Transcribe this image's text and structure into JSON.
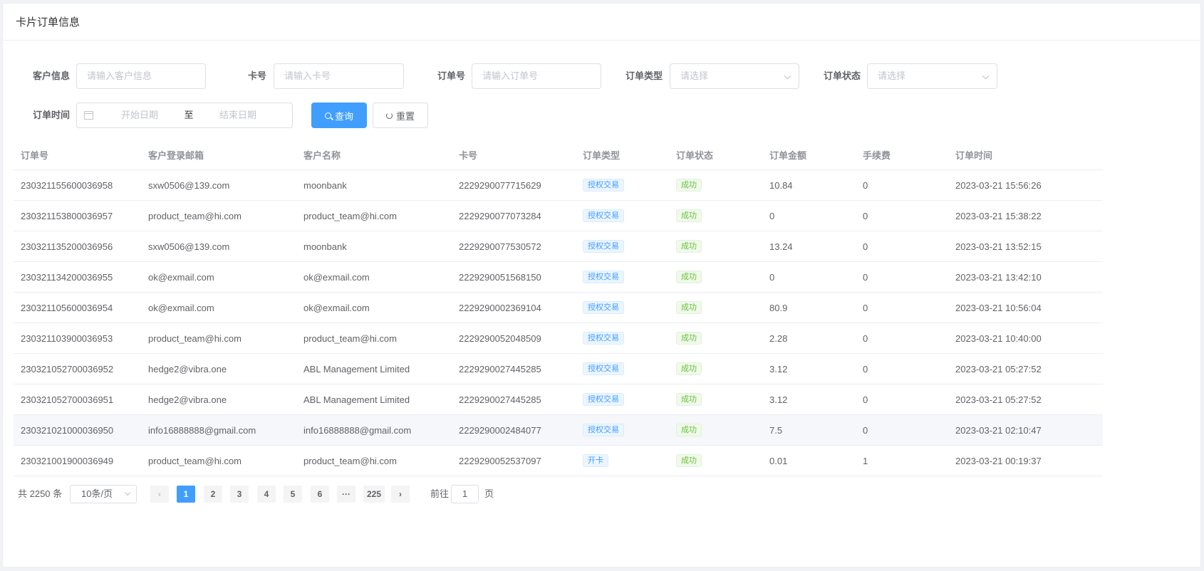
{
  "header": {
    "title": "卡片订单信息"
  },
  "filters": {
    "customer_label": "客户信息",
    "customer_placeholder": "请输入客户信息",
    "card_label": "卡号",
    "card_placeholder": "请输入卡号",
    "order_label": "订单号",
    "order_placeholder": "请输入订单号",
    "type_label": "订单类型",
    "type_placeholder": "请选择",
    "status_label": "订单状态",
    "status_placeholder": "请选择",
    "time_label": "订单时间",
    "start_placeholder": "开始日期",
    "range_separator": "至",
    "end_placeholder": "结束日期",
    "search_label": "查询",
    "reset_label": "重置"
  },
  "table": {
    "columns": [
      "订单号",
      "客户登录邮箱",
      "客户名称",
      "卡号",
      "订单类型",
      "订单状态",
      "订单金额",
      "手续费",
      "订单时间"
    ],
    "rows": [
      {
        "order_no": "230321155600036958",
        "email": "sxw0506@139.com",
        "name": "moonbank",
        "card": "2229290077715629",
        "type": "授权交易",
        "status": "成功",
        "amount": "10.84",
        "fee": "0",
        "time": "2023-03-21 15:56:26"
      },
      {
        "order_no": "230321153800036957",
        "email": "product_team@hi.com",
        "name": "product_team@hi.com",
        "card": "2229290077073284",
        "type": "授权交易",
        "status": "成功",
        "amount": "0",
        "fee": "0",
        "time": "2023-03-21 15:38:22"
      },
      {
        "order_no": "230321135200036956",
        "email": "sxw0506@139.com",
        "name": "moonbank",
        "card": "2229290077530572",
        "type": "授权交易",
        "status": "成功",
        "amount": "13.24",
        "fee": "0",
        "time": "2023-03-21 13:52:15"
      },
      {
        "order_no": "230321134200036955",
        "email": "ok@exmail.com",
        "name": "ok@exmail.com",
        "card": "2229290051568150",
        "type": "授权交易",
        "status": "成功",
        "amount": "0",
        "fee": "0",
        "time": "2023-03-21 13:42:10"
      },
      {
        "order_no": "230321105600036954",
        "email": "ok@exmail.com",
        "name": "ok@exmail.com",
        "card": "2229290002369104",
        "type": "授权交易",
        "status": "成功",
        "amount": "80.9",
        "fee": "0",
        "time": "2023-03-21 10:56:04"
      },
      {
        "order_no": "230321103900036953",
        "email": "product_team@hi.com",
        "name": "product_team@hi.com",
        "card": "2229290052048509",
        "type": "授权交易",
        "status": "成功",
        "amount": "2.28",
        "fee": "0",
        "time": "2023-03-21 10:40:00"
      },
      {
        "order_no": "230321052700036952",
        "email": "hedge2@vibra.one",
        "name": "ABL Management Limited",
        "card": "2229290027445285",
        "type": "授权交易",
        "status": "成功",
        "amount": "3.12",
        "fee": "0",
        "time": "2023-03-21 05:27:52"
      },
      {
        "order_no": "230321052700036951",
        "email": "hedge2@vibra.one",
        "name": "ABL Management Limited",
        "card": "2229290027445285",
        "type": "授权交易",
        "status": "成功",
        "amount": "3.12",
        "fee": "0",
        "time": "2023-03-21 05:27:52"
      },
      {
        "order_no": "230321021000036950",
        "email": "info16888888@gmail.com",
        "name": "info16888888@gmail.com",
        "card": "2229290002484077",
        "type": "授权交易",
        "status": "成功",
        "amount": "7.5",
        "fee": "0",
        "time": "2023-03-21 02:10:47"
      },
      {
        "order_no": "230321001900036949",
        "email": "product_team@hi.com",
        "name": "product_team@hi.com",
        "card": "2229290052537097",
        "type": "开卡",
        "status": "成功",
        "amount": "0.01",
        "fee": "1",
        "time": "2023-03-21 00:19:37"
      }
    ]
  },
  "pagination": {
    "total_text": "共 2250 条",
    "page_size": "10条/页",
    "pages": [
      "1",
      "2",
      "3",
      "4",
      "5",
      "6"
    ],
    "ellipsis": "···",
    "last_page": "225",
    "current_page": "1",
    "goto_prefix": "前往",
    "goto_value": "1",
    "goto_suffix": "页"
  }
}
